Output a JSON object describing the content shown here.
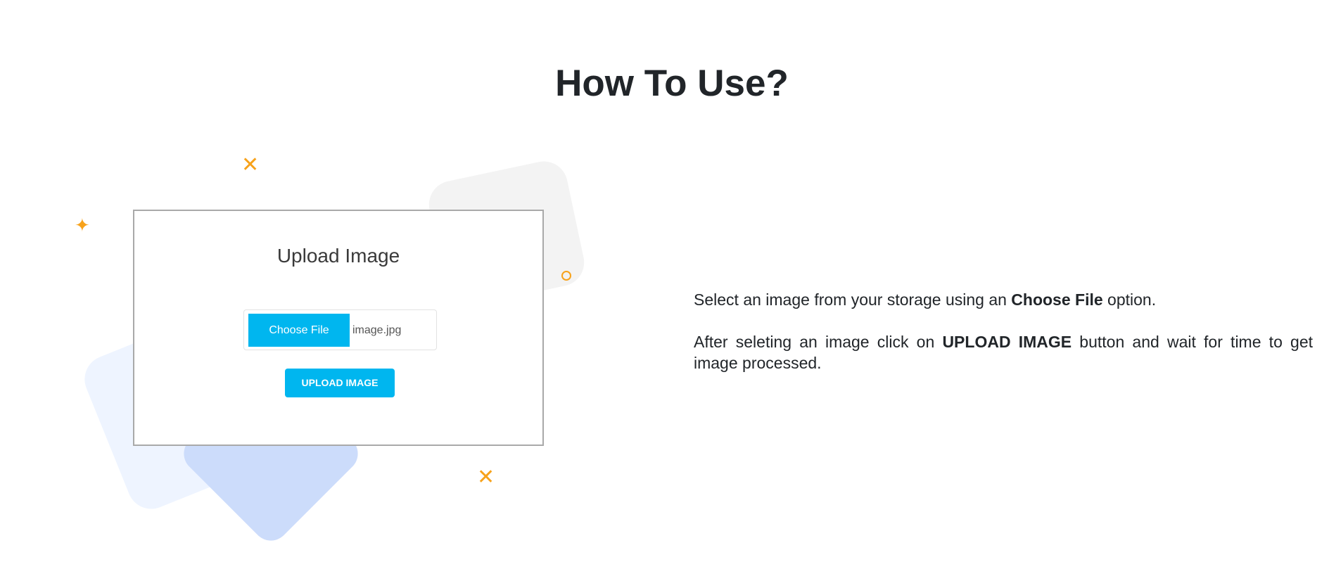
{
  "section": {
    "title": "How To Use?"
  },
  "mockup": {
    "title": "Upload Image",
    "choose_file_label": "Choose File",
    "file_name": "image.jpg",
    "upload_button_label": "UPLOAD IMAGE"
  },
  "instructions": {
    "step1": {
      "before": "Select an image from your storage using an ",
      "bold": "Choose File",
      "after": " option."
    },
    "step2": {
      "before": "After seleting an image click on ",
      "bold": "UPLOAD IMAGE",
      "after": " button and wait for time to get image processed."
    }
  },
  "colors": {
    "accent": "#00b6ef",
    "decoration": "#f7a21b",
    "heading": "#212529"
  },
  "decorations": [
    {
      "icon": "sparkle-star-icon"
    },
    {
      "icon": "sparkle-x-icon"
    },
    {
      "icon": "circle-outline-icon"
    }
  ]
}
